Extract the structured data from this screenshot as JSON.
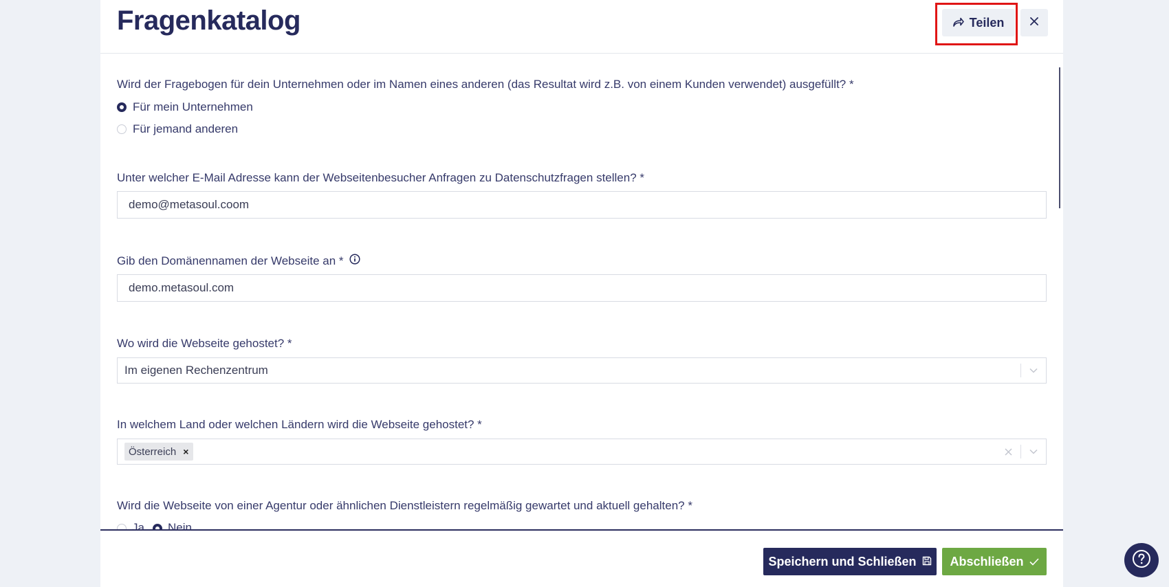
{
  "header": {
    "title": "Fragenkatalog",
    "share_label": "Teilen",
    "share_icon": "share-arrow-icon",
    "close_icon": "close-icon"
  },
  "questions": {
    "q1": {
      "label": "Wird der Fragebogen für dein Unternehmen oder im Namen eines anderen (das Resultat wird z.B. von einem Kunden verwendet) ausgefüllt? *",
      "options": [
        "Für mein Unternehmen",
        "Für jemand anderen"
      ],
      "selected": "Für mein Unternehmen"
    },
    "q2": {
      "label": "Unter welcher E-Mail Adresse kann der Webseitenbesucher Anfragen zu Datenschutzfragen stellen? *",
      "value": "demo@metasoul.coom"
    },
    "q3": {
      "label": "Gib den Domänennamen der Webseite an *",
      "info_icon": "info-icon",
      "value": "demo.metasoul.com"
    },
    "q4": {
      "label": "Wo wird die Webseite gehostet? *",
      "selected": "Im eigenen Rechenzentrum"
    },
    "q5": {
      "label": "In welchem Land oder welchen Ländern wird die Webseite gehostet? *",
      "tags": [
        "Österreich"
      ]
    },
    "q6": {
      "label": "Wird die Webseite von einer Agentur oder ähnlichen Dienstleistern regelmäßig gewartet und aktuell gehalten? *",
      "options": [
        "Ja",
        "Nein"
      ],
      "selected": "Nein"
    }
  },
  "footer": {
    "save_label": "Speichern und Schließen",
    "save_icon": "save-disk-icon",
    "finish_label": "Abschließen",
    "finish_icon": "checkmark-icon"
  },
  "help": {
    "icon": "help-question-icon"
  },
  "colors": {
    "primary": "#262a5c",
    "success": "#6da843",
    "highlight": "#e01515",
    "background": "#eef1f6"
  }
}
